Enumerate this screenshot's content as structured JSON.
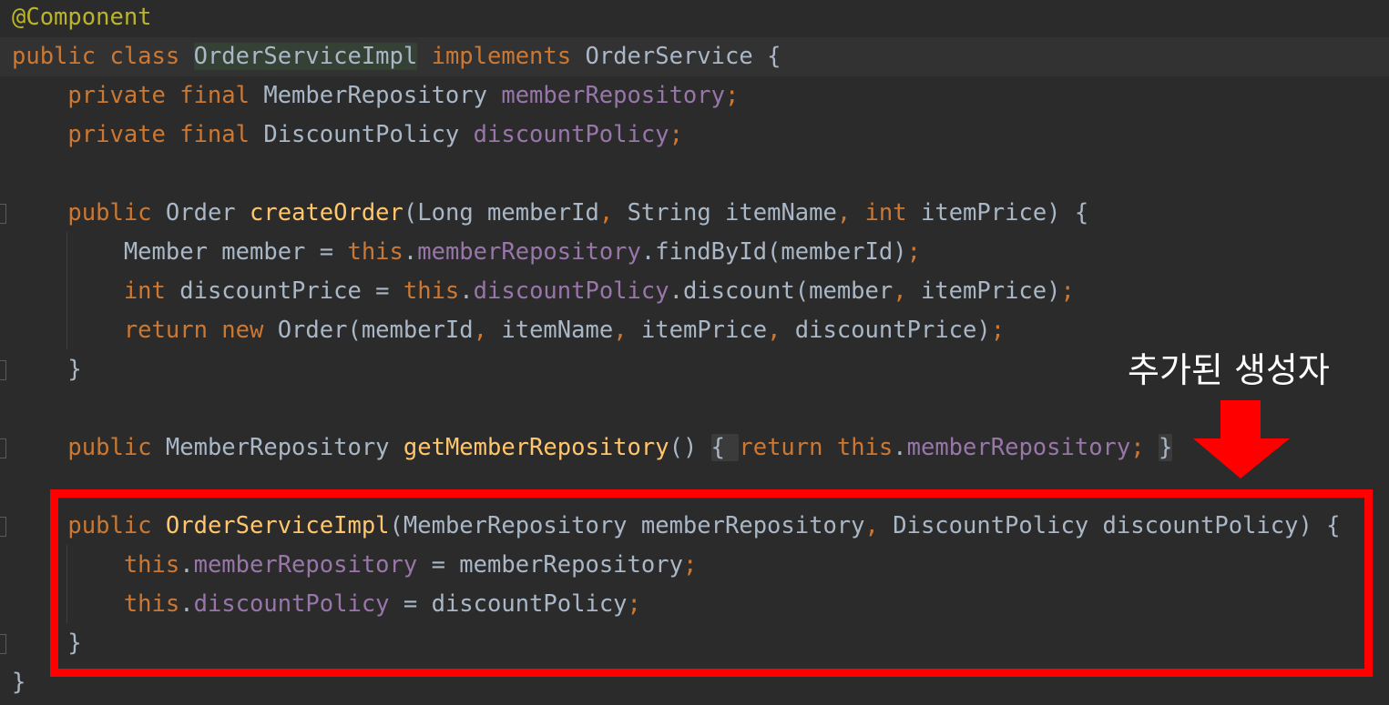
{
  "code": {
    "lines": [
      {
        "tokens": [
          {
            "t": "@Component",
            "c": "ann"
          }
        ]
      },
      {
        "current": true,
        "tokens": [
          {
            "t": "public class ",
            "c": "kw"
          },
          {
            "t": "OrderServiceImpl",
            "c": "def hl-name"
          },
          {
            "t": " ",
            "c": "def"
          },
          {
            "t": "implements ",
            "c": "kw"
          },
          {
            "t": "OrderService {",
            "c": "def"
          }
        ]
      },
      {
        "tokens": [
          {
            "t": "    private final ",
            "c": "kw"
          },
          {
            "t": "MemberRepository ",
            "c": "def"
          },
          {
            "t": "memberRepository",
            "c": "fld"
          },
          {
            "t": ";",
            "c": "kw"
          }
        ]
      },
      {
        "tokens": [
          {
            "t": "    private final ",
            "c": "kw"
          },
          {
            "t": "DiscountPolicy ",
            "c": "def"
          },
          {
            "t": "discountPolicy",
            "c": "fld"
          },
          {
            "t": ";",
            "c": "kw"
          }
        ]
      },
      {
        "tokens": []
      },
      {
        "tokens": [
          {
            "t": "    public ",
            "c": "kw"
          },
          {
            "t": "Order ",
            "c": "def"
          },
          {
            "t": "createOrder",
            "c": "fn"
          },
          {
            "t": "(Long memberId",
            "c": "def"
          },
          {
            "t": ", ",
            "c": "kw"
          },
          {
            "t": "String itemName",
            "c": "def"
          },
          {
            "t": ", ",
            "c": "kw"
          },
          {
            "t": "int ",
            "c": "kw"
          },
          {
            "t": "itemPrice) {",
            "c": "def"
          }
        ]
      },
      {
        "tokens": [
          {
            "t": "        Member member = ",
            "c": "def"
          },
          {
            "t": "this",
            "c": "kw"
          },
          {
            "t": ".",
            "c": "def"
          },
          {
            "t": "memberRepository",
            "c": "fld"
          },
          {
            "t": ".findById(memberId)",
            "c": "def"
          },
          {
            "t": ";",
            "c": "kw"
          }
        ]
      },
      {
        "tokens": [
          {
            "t": "        int ",
            "c": "kw"
          },
          {
            "t": "discountPrice = ",
            "c": "def"
          },
          {
            "t": "this",
            "c": "kw"
          },
          {
            "t": ".",
            "c": "def"
          },
          {
            "t": "discountPolicy",
            "c": "fld"
          },
          {
            "t": ".discount(member",
            "c": "def"
          },
          {
            "t": ", ",
            "c": "kw"
          },
          {
            "t": "itemPrice)",
            "c": "def"
          },
          {
            "t": ";",
            "c": "kw"
          }
        ]
      },
      {
        "tokens": [
          {
            "t": "        return new ",
            "c": "kw"
          },
          {
            "t": "Order(memberId",
            "c": "def"
          },
          {
            "t": ", ",
            "c": "kw"
          },
          {
            "t": "itemName",
            "c": "def"
          },
          {
            "t": ", ",
            "c": "kw"
          },
          {
            "t": "itemPrice",
            "c": "def"
          },
          {
            "t": ", ",
            "c": "kw"
          },
          {
            "t": "discountPrice)",
            "c": "def"
          },
          {
            "t": ";",
            "c": "kw"
          }
        ]
      },
      {
        "tokens": [
          {
            "t": "    }",
            "c": "def"
          }
        ]
      },
      {
        "tokens": []
      },
      {
        "tokens": [
          {
            "t": "    public ",
            "c": "kw"
          },
          {
            "t": "MemberRepository ",
            "c": "def"
          },
          {
            "t": "getMemberRepository",
            "c": "fn"
          },
          {
            "t": "() ",
            "c": "def"
          },
          {
            "t": "{ ",
            "c": "def fold-bg"
          },
          {
            "t": "return this",
            "c": "kw"
          },
          {
            "t": ".",
            "c": "def"
          },
          {
            "t": "memberRepository",
            "c": "fld"
          },
          {
            "t": "; ",
            "c": "kw"
          },
          {
            "t": "}",
            "c": "def fold-bg"
          }
        ]
      },
      {
        "tokens": []
      },
      {
        "tokens": [
          {
            "t": "    public ",
            "c": "kw"
          },
          {
            "t": "OrderServiceImpl",
            "c": "fn"
          },
          {
            "t": "(MemberRepository memberRepository",
            "c": "def"
          },
          {
            "t": ", ",
            "c": "kw"
          },
          {
            "t": "DiscountPolicy discountPolicy) {",
            "c": "def"
          }
        ]
      },
      {
        "tokens": [
          {
            "t": "        this",
            "c": "kw"
          },
          {
            "t": ".",
            "c": "def"
          },
          {
            "t": "memberRepository",
            "c": "fld"
          },
          {
            "t": " = memberRepository",
            "c": "def"
          },
          {
            "t": ";",
            "c": "kw"
          }
        ]
      },
      {
        "tokens": [
          {
            "t": "        this",
            "c": "kw"
          },
          {
            "t": ".",
            "c": "def"
          },
          {
            "t": "discountPolicy",
            "c": "fld"
          },
          {
            "t": " = discountPolicy",
            "c": "def"
          },
          {
            "t": ";",
            "c": "kw"
          }
        ]
      },
      {
        "tokens": [
          {
            "t": "    }",
            "c": "def"
          }
        ]
      },
      {
        "tokens": [
          {
            "t": "}",
            "c": "def"
          }
        ]
      }
    ]
  },
  "annotation": {
    "label": "추가된 생성자",
    "box_color": "#ff0000",
    "arrow_color": "#ff0000"
  },
  "colors": {
    "background": "#2b2b2b",
    "keyword": "#cc7832",
    "field": "#9876aa",
    "method": "#ffc66d",
    "annotation": "#bbb529",
    "default": "#a9b7c6"
  }
}
